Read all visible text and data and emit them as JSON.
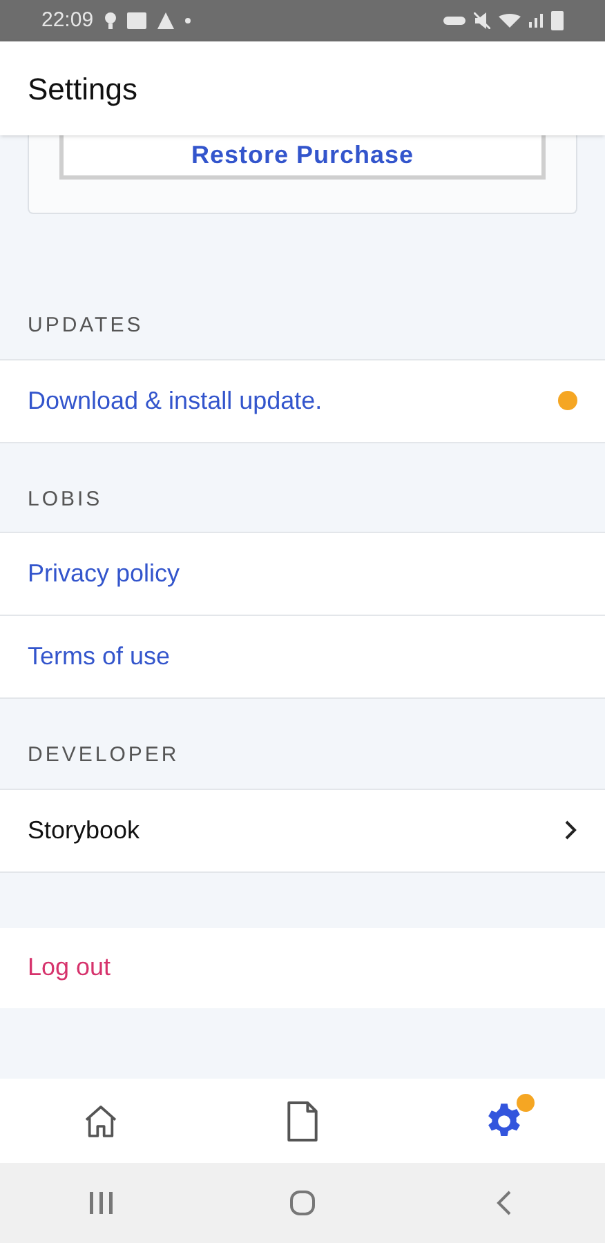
{
  "status_bar": {
    "time": "22:09"
  },
  "header": {
    "title": "Settings"
  },
  "restore_button": {
    "label": "Restore Purchase"
  },
  "sections": [
    {
      "title": "UPDATES",
      "items": [
        {
          "label": "Download & install update.",
          "kind": "link",
          "dot": true
        }
      ]
    },
    {
      "title": "LOBIS",
      "items": [
        {
          "label": "Privacy policy",
          "kind": "link",
          "dot": false
        },
        {
          "label": "Terms of use",
          "kind": "link",
          "dot": false
        }
      ]
    },
    {
      "title": "DEVELOPER",
      "items": [
        {
          "label": "Storybook",
          "kind": "nav",
          "dot": false
        }
      ]
    }
  ],
  "logout": {
    "label": "Log out"
  },
  "tabs": [
    {
      "kind": "home",
      "selected": false,
      "dot": false
    },
    {
      "kind": "document",
      "selected": false,
      "dot": false
    },
    {
      "kind": "settings",
      "selected": true,
      "dot": true
    }
  ]
}
